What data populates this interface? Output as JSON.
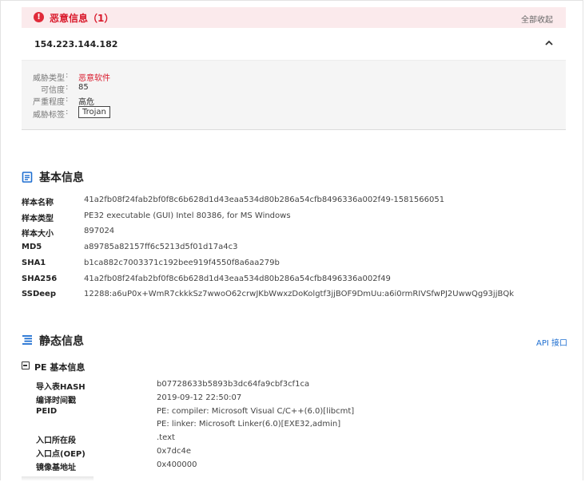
{
  "malicious": {
    "title": "恶意信息（1）",
    "collapse_all": "全部收起",
    "accent_color": "#d9192b",
    "icon": "alert-circle-icon"
  },
  "indicator": {
    "ip": "154.223.144.182",
    "expanded": true,
    "toggle_icon": "chevron-up-icon"
  },
  "threat": {
    "rows": [
      {
        "label": "威胁类型",
        "value": "恶意软件"
      },
      {
        "label": "可信度",
        "value": "85"
      },
      {
        "label": "严重程度",
        "value": "高危"
      },
      {
        "label": "威胁标签",
        "value": "Trojan"
      }
    ]
  },
  "basic": {
    "title": "基本信息",
    "icon": "document-icon",
    "rows": [
      {
        "key": "样本名称",
        "value": "41a2fb08f24fab2bf0f8c6b628d1d43eaa534d80b286a54cfb8496336a002f49-1581566051"
      },
      {
        "key": "样本类型",
        "value": "PE32 executable (GUI) Intel 80386, for MS Windows"
      },
      {
        "key": "样本大小",
        "value": "897024"
      },
      {
        "key": "MD5",
        "value": "a89785a82157ff6c5213d5f01d17a4c3"
      },
      {
        "key": "SHA1",
        "value": "b1ca882c7003371c192bee919f4550f8a6aa279b"
      },
      {
        "key": "SHA256",
        "value": "41a2fb08f24fab2bf0f8c6b628d1d43eaa534d80b286a54cfb8496336a002f49"
      },
      {
        "key": "SSDeep",
        "value": "12288:a6uP0x+WmR7ckkkSz7wwoO62crwJKbWwxzDoKolgtf3jjBOF9DmUu:a6i0rmRIVSfwPJ2UwwQg93jjBQk"
      }
    ]
  },
  "static": {
    "title": "静态信息",
    "icon": "list-icon",
    "api_link": "API 接口",
    "pe": {
      "title": "PE 基本信息",
      "rows": [
        {
          "key": "导入表HASH",
          "value": "b07728633b5893b3dc64fa9cbf3cf1ca"
        },
        {
          "key": "编译时间戳",
          "value": "2019-09-12 22:50:07"
        },
        {
          "key": "PEID",
          "value": "PE: compiler: Microsoft Visual C/C++(6.0)[libcmt]"
        },
        {
          "key": "",
          "value": "PE: linker: Microsoft Linker(6.0)[EXE32,admin]"
        },
        {
          "key": "入口所在段",
          "value": ".text"
        },
        {
          "key": "入口点(OEP)",
          "value": "0x7dc4e"
        },
        {
          "key": "镜像基地址",
          "value": "0x400000"
        }
      ]
    }
  }
}
